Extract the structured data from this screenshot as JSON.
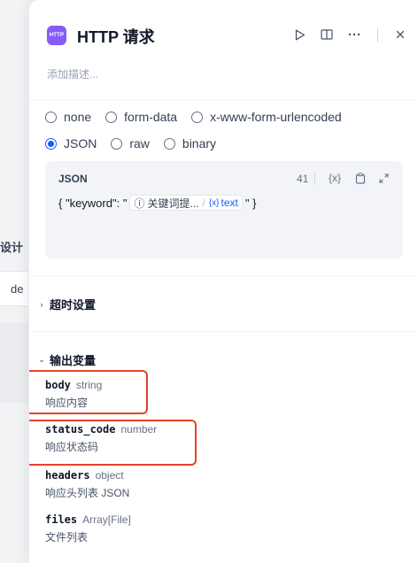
{
  "background": {
    "fragment_label": "设计",
    "fragment_input": "de"
  },
  "header": {
    "app_icon_text": "HTTP",
    "title": "HTTP 请求",
    "run_icon": "play-icon",
    "split_icon": "book-icon",
    "more_icon": "more-icon",
    "close_icon": "close-icon",
    "description_placeholder": "添加描述..."
  },
  "body_types": [
    {
      "label": "none",
      "selected": false
    },
    {
      "label": "form-data",
      "selected": false
    },
    {
      "label": "x-www-form-urlencoded",
      "selected": false
    },
    {
      "label": "JSON",
      "selected": true
    },
    {
      "label": "raw",
      "selected": false
    },
    {
      "label": "binary",
      "selected": false
    }
  ],
  "json_editor": {
    "label": "JSON",
    "count": "41",
    "variable_icon": "{x}",
    "copy_icon": "copy-icon",
    "expand_icon": "expand-icon",
    "prefix": "{ \"keyword\": \"",
    "node_icon": "ⓘ",
    "node_name": "关键词提...",
    "var_icon": "{x}",
    "var_name": "text",
    "suffix": "\" }"
  },
  "timeout_section": {
    "title": "超时设置"
  },
  "output_section": {
    "title": "输出变量",
    "variables": [
      {
        "name": "body",
        "type": "string",
        "description": "响应内容"
      },
      {
        "name": "status_code",
        "type": "number",
        "description": "响应状态码"
      },
      {
        "name": "headers",
        "type": "object",
        "description": "响应头列表 JSON"
      },
      {
        "name": "files",
        "type": "Array[File]",
        "description": "文件列表"
      }
    ]
  },
  "colors": {
    "accent": "#155eef",
    "app_icon": "#875bf7",
    "highlight": "#e5432a"
  }
}
